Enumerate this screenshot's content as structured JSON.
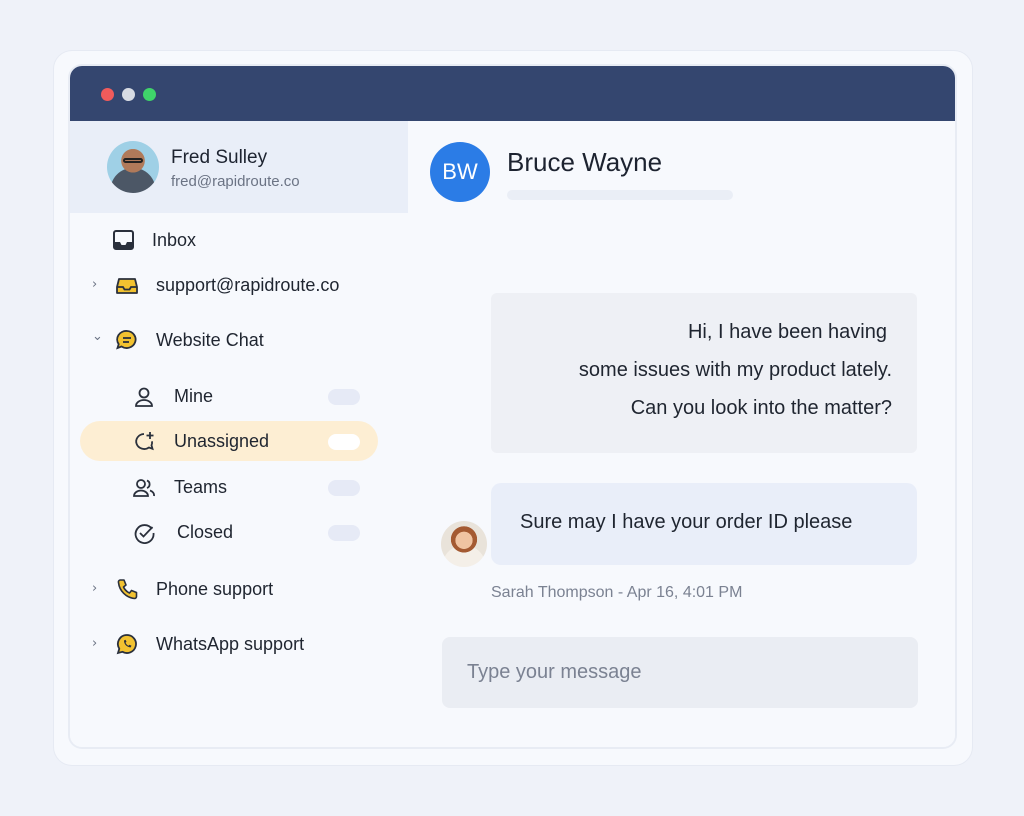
{
  "user": {
    "name": "Fred Sulley",
    "email": "fred@rapidroute.co"
  },
  "sidebar": {
    "inbox_label": "Inbox",
    "channels": [
      {
        "label": "support@rapidroute.co",
        "icon": "inbox-tray-icon",
        "expanded": false
      },
      {
        "label": "Website Chat",
        "icon": "chat-bubble-icon",
        "expanded": true
      },
      {
        "label": "Phone support",
        "icon": "phone-icon",
        "expanded": false
      },
      {
        "label": "WhatsApp support",
        "icon": "whatsapp-icon",
        "expanded": false
      }
    ],
    "chat_filters": [
      {
        "label": "Mine",
        "icon": "user-icon",
        "active": false
      },
      {
        "label": "Unassigned",
        "icon": "chat-add-icon",
        "active": true
      },
      {
        "label": "Teams",
        "icon": "team-icon",
        "active": false
      },
      {
        "label": "Closed",
        "icon": "check-circle-icon",
        "active": false
      }
    ]
  },
  "conversation": {
    "contact_initials": "BW",
    "contact_name": "Bruce Wayne",
    "incoming_lines": [
      "Hi, I have been having",
      "some issues with my product lately.",
      "Can you look into the matter?"
    ],
    "reply_text": "Sure may I have your order ID please",
    "reply_meta": "Sarah Thompson - Apr 16, 4:01 PM",
    "composer_placeholder": "Type your message"
  },
  "colors": {
    "titlebar": "#34466f",
    "accent_blue": "#2b7ce6",
    "active_filter": "#fdeed3",
    "icon_yellow": "#f2c230"
  }
}
